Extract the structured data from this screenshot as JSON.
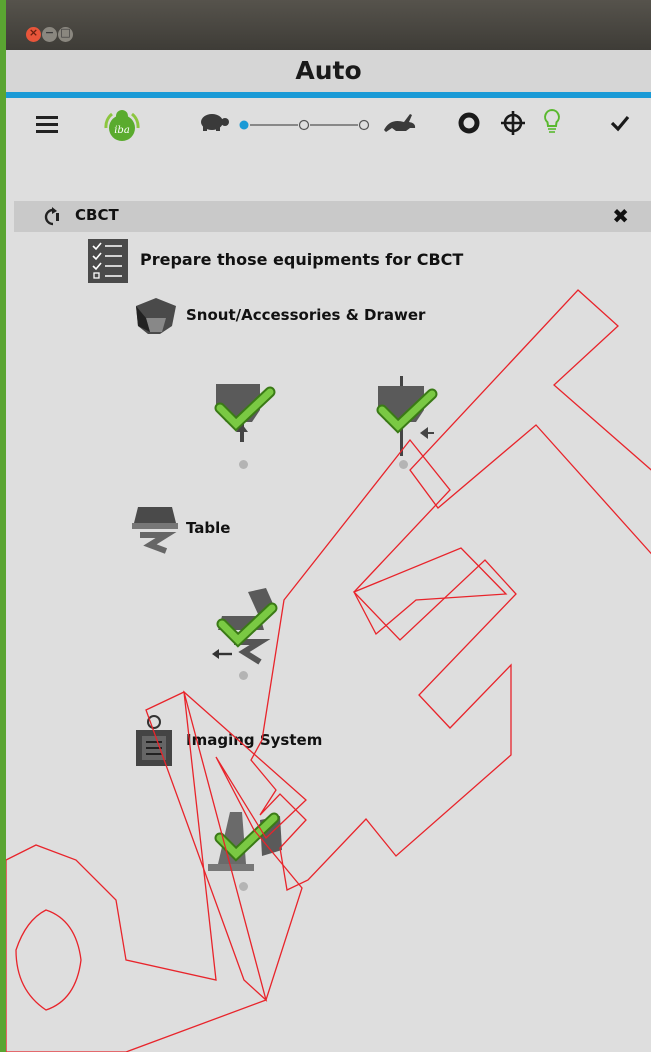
{
  "window": {
    "title": "Auto",
    "controls": {
      "close": "×",
      "minimize": "−",
      "maximize": "□"
    },
    "accent_color": "#1a9ad6"
  },
  "toolbar": {
    "menu_icon": "hamburger-icon",
    "logo_icon": "iba-logo-icon",
    "speed": {
      "slow_icon": "turtle-icon",
      "fast_icon": "rabbit-icon",
      "selected_step": 1,
      "steps": 3
    },
    "icons": [
      "ring-icon",
      "crosshair-icon",
      "lightbulb-icon",
      "checkmark-icon"
    ],
    "status_green": "#59b82e"
  },
  "section": {
    "icon": "rotate-icon",
    "label": "CBCT",
    "close": "✖"
  },
  "checklist": {
    "title": "Prepare those equipments for CBCT",
    "groups": [
      {
        "label": "Snout/Accessories & Drawer",
        "icon": "snout-icon",
        "items": [
          "snout-retracted-ok",
          "snout-centered-ok"
        ]
      },
      {
        "label": "Table",
        "icon": "table-icon",
        "items": [
          "table-position-ok"
        ]
      },
      {
        "label": "Imaging System",
        "icon": "imaging-system-icon",
        "items": [
          "imaging-position-ok"
        ]
      }
    ]
  },
  "watermark": {
    "color": "#e8242b"
  }
}
